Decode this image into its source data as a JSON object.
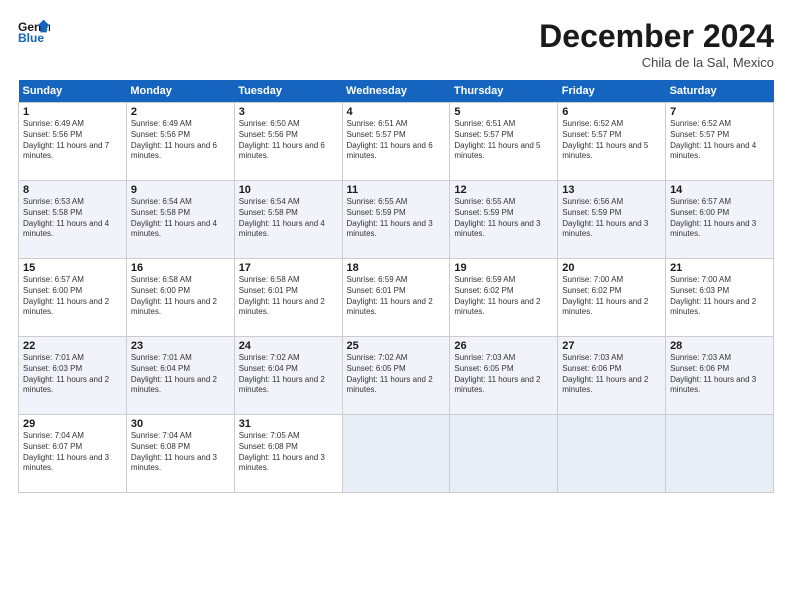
{
  "header": {
    "logo_line1": "General",
    "logo_line2": "Blue",
    "month": "December 2024",
    "location": "Chila de la Sal, Mexico"
  },
  "weekdays": [
    "Sunday",
    "Monday",
    "Tuesday",
    "Wednesday",
    "Thursday",
    "Friday",
    "Saturday"
  ],
  "weeks": [
    [
      {
        "day": "1",
        "sunrise": "6:49 AM",
        "sunset": "5:56 PM",
        "daylight": "11 hours and 7 minutes."
      },
      {
        "day": "2",
        "sunrise": "6:49 AM",
        "sunset": "5:56 PM",
        "daylight": "11 hours and 6 minutes."
      },
      {
        "day": "3",
        "sunrise": "6:50 AM",
        "sunset": "5:56 PM",
        "daylight": "11 hours and 6 minutes."
      },
      {
        "day": "4",
        "sunrise": "6:51 AM",
        "sunset": "5:57 PM",
        "daylight": "11 hours and 6 minutes."
      },
      {
        "day": "5",
        "sunrise": "6:51 AM",
        "sunset": "5:57 PM",
        "daylight": "11 hours and 5 minutes."
      },
      {
        "day": "6",
        "sunrise": "6:52 AM",
        "sunset": "5:57 PM",
        "daylight": "11 hours and 5 minutes."
      },
      {
        "day": "7",
        "sunrise": "6:52 AM",
        "sunset": "5:57 PM",
        "daylight": "11 hours and 4 minutes."
      }
    ],
    [
      {
        "day": "8",
        "sunrise": "6:53 AM",
        "sunset": "5:58 PM",
        "daylight": "11 hours and 4 minutes."
      },
      {
        "day": "9",
        "sunrise": "6:54 AM",
        "sunset": "5:58 PM",
        "daylight": "11 hours and 4 minutes."
      },
      {
        "day": "10",
        "sunrise": "6:54 AM",
        "sunset": "5:58 PM",
        "daylight": "11 hours and 4 minutes."
      },
      {
        "day": "11",
        "sunrise": "6:55 AM",
        "sunset": "5:59 PM",
        "daylight": "11 hours and 3 minutes."
      },
      {
        "day": "12",
        "sunrise": "6:55 AM",
        "sunset": "5:59 PM",
        "daylight": "11 hours and 3 minutes."
      },
      {
        "day": "13",
        "sunrise": "6:56 AM",
        "sunset": "5:59 PM",
        "daylight": "11 hours and 3 minutes."
      },
      {
        "day": "14",
        "sunrise": "6:57 AM",
        "sunset": "6:00 PM",
        "daylight": "11 hours and 3 minutes."
      }
    ],
    [
      {
        "day": "15",
        "sunrise": "6:57 AM",
        "sunset": "6:00 PM",
        "daylight": "11 hours and 2 minutes."
      },
      {
        "day": "16",
        "sunrise": "6:58 AM",
        "sunset": "6:00 PM",
        "daylight": "11 hours and 2 minutes."
      },
      {
        "day": "17",
        "sunrise": "6:58 AM",
        "sunset": "6:01 PM",
        "daylight": "11 hours and 2 minutes."
      },
      {
        "day": "18",
        "sunrise": "6:59 AM",
        "sunset": "6:01 PM",
        "daylight": "11 hours and 2 minutes."
      },
      {
        "day": "19",
        "sunrise": "6:59 AM",
        "sunset": "6:02 PM",
        "daylight": "11 hours and 2 minutes."
      },
      {
        "day": "20",
        "sunrise": "7:00 AM",
        "sunset": "6:02 PM",
        "daylight": "11 hours and 2 minutes."
      },
      {
        "day": "21",
        "sunrise": "7:00 AM",
        "sunset": "6:03 PM",
        "daylight": "11 hours and 2 minutes."
      }
    ],
    [
      {
        "day": "22",
        "sunrise": "7:01 AM",
        "sunset": "6:03 PM",
        "daylight": "11 hours and 2 minutes."
      },
      {
        "day": "23",
        "sunrise": "7:01 AM",
        "sunset": "6:04 PM",
        "daylight": "11 hours and 2 minutes."
      },
      {
        "day": "24",
        "sunrise": "7:02 AM",
        "sunset": "6:04 PM",
        "daylight": "11 hours and 2 minutes."
      },
      {
        "day": "25",
        "sunrise": "7:02 AM",
        "sunset": "6:05 PM",
        "daylight": "11 hours and 2 minutes."
      },
      {
        "day": "26",
        "sunrise": "7:03 AM",
        "sunset": "6:05 PM",
        "daylight": "11 hours and 2 minutes."
      },
      {
        "day": "27",
        "sunrise": "7:03 AM",
        "sunset": "6:06 PM",
        "daylight": "11 hours and 2 minutes."
      },
      {
        "day": "28",
        "sunrise": "7:03 AM",
        "sunset": "6:06 PM",
        "daylight": "11 hours and 3 minutes."
      }
    ],
    [
      {
        "day": "29",
        "sunrise": "7:04 AM",
        "sunset": "6:07 PM",
        "daylight": "11 hours and 3 minutes."
      },
      {
        "day": "30",
        "sunrise": "7:04 AM",
        "sunset": "6:08 PM",
        "daylight": "11 hours and 3 minutes."
      },
      {
        "day": "31",
        "sunrise": "7:05 AM",
        "sunset": "6:08 PM",
        "daylight": "11 hours and 3 minutes."
      },
      null,
      null,
      null,
      null
    ]
  ]
}
